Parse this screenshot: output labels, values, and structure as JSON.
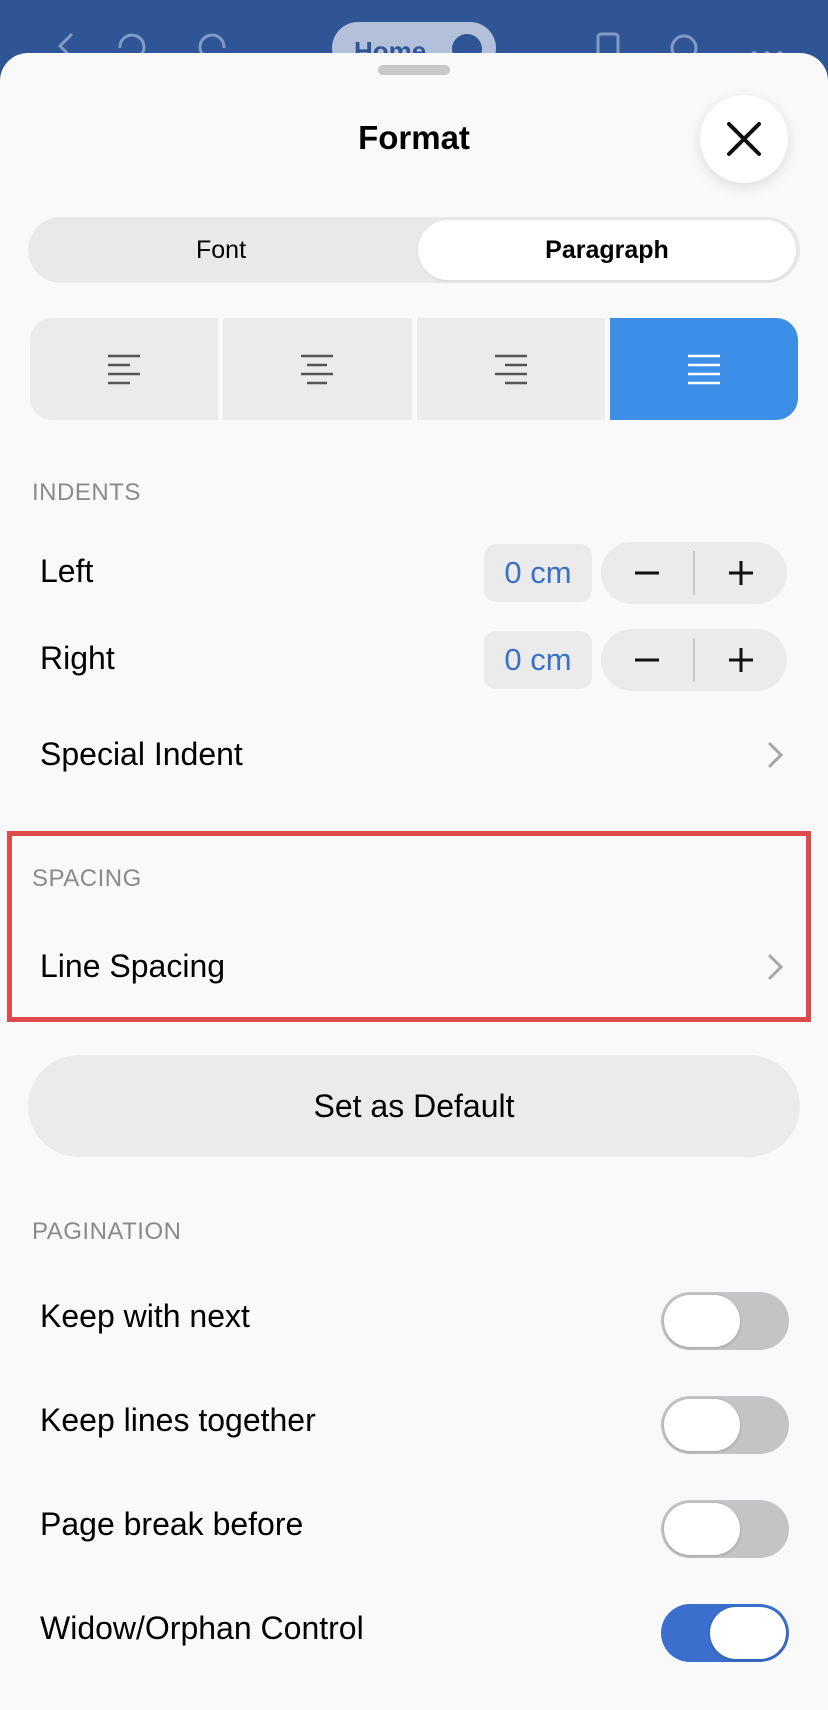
{
  "sheet": {
    "title": "Format",
    "tabs": [
      {
        "label": "Font",
        "selected": false
      },
      {
        "label": "Paragraph",
        "selected": true
      }
    ],
    "alignment": {
      "options": [
        "align-left",
        "align-center",
        "align-right",
        "justify"
      ],
      "selected": "justify",
      "accent_color": "#3d8ee6"
    },
    "indents": {
      "header": "INDENTS",
      "left": {
        "label": "Left",
        "value": "0 cm"
      },
      "right": {
        "label": "Right",
        "value": "0 cm"
      },
      "special": {
        "label": "Special Indent"
      }
    },
    "spacing": {
      "header": "SPACING",
      "line_spacing": {
        "label": "Line Spacing"
      }
    },
    "set_default_label": "Set as Default",
    "pagination": {
      "header": "PAGINATION",
      "items": [
        {
          "label": "Keep with next",
          "on": false
        },
        {
          "label": "Keep lines together",
          "on": false
        },
        {
          "label": "Page break before",
          "on": false
        },
        {
          "label": "Widow/Orphan Control",
          "on": true
        }
      ]
    }
  },
  "app_bar": {
    "home_label": "Home"
  },
  "colors": {
    "app_bar": "#2f5597",
    "highlight_border": "#dd4b4b",
    "value_text": "#3a72c6",
    "toggle_on": "#3a6fcd"
  }
}
